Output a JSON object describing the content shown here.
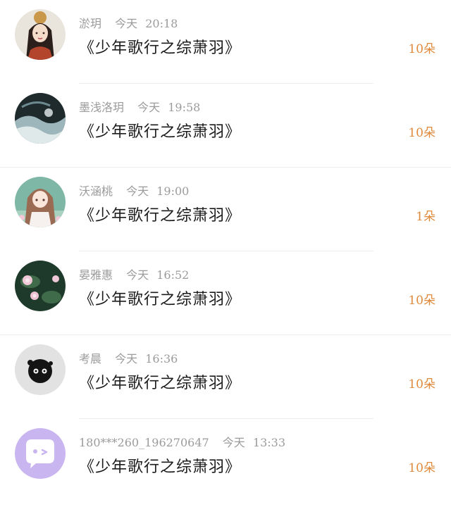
{
  "items": [
    {
      "name": "淤玥",
      "day": "今天",
      "time": "20:18",
      "title": "《少年歌行之综萧羽》",
      "count": "10朵",
      "avatar": "avatar-ancient-girl"
    },
    {
      "name": "墨浅洛玥",
      "day": "今天",
      "time": "19:58",
      "title": "《少年歌行之综萧羽》",
      "count": "10朵",
      "avatar": "avatar-ink-painting"
    },
    {
      "name": "沃涵桃",
      "day": "今天",
      "time": "19:00",
      "title": "《少年歌行之综萧羽》",
      "count": "1朵",
      "avatar": "avatar-anime-girl"
    },
    {
      "name": "晏雅惠",
      "day": "今天",
      "time": "16:52",
      "title": "《少年歌行之综萧羽》",
      "count": "10朵",
      "avatar": "avatar-lotus"
    },
    {
      "name": "考晨",
      "day": "今天",
      "time": "16:36",
      "title": "《少年歌行之综萧羽》",
      "count": "10朵",
      "avatar": "avatar-soot-sprite"
    },
    {
      "name": "180***260_196270647",
      "day": "今天",
      "time": "13:33",
      "title": "《少年歌行之综萧羽》",
      "count": "10朵",
      "avatar": "avatar-default-chat"
    }
  ],
  "colors": {
    "count": "#e08a3c",
    "meta": "#9b9b9b",
    "title": "#1c1c1c",
    "divider": "#ededed"
  }
}
